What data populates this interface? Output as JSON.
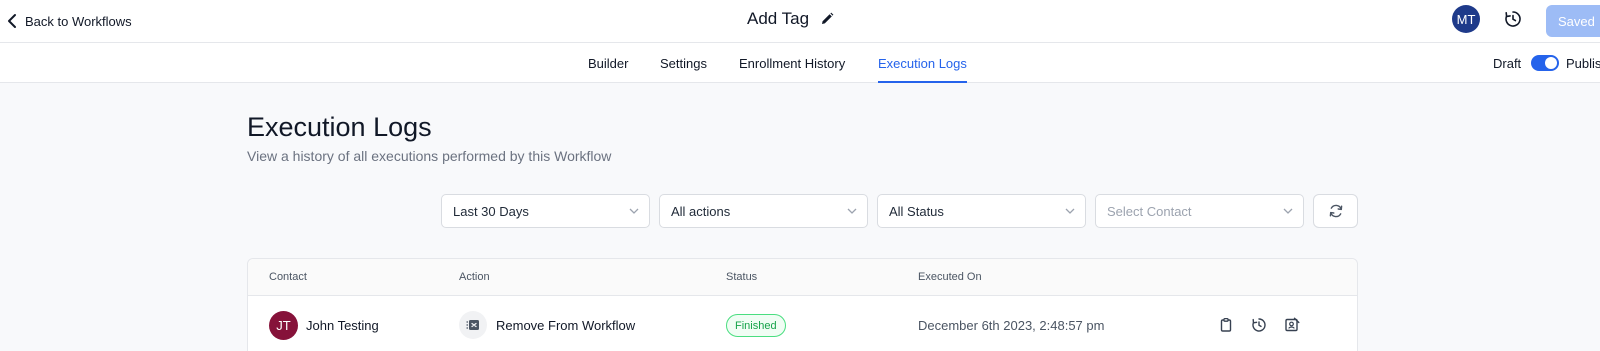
{
  "header": {
    "back_label": "Back to Workflows",
    "title": "Add Tag",
    "avatar_initials": "MT",
    "saved_label": "Saved"
  },
  "tabs": [
    {
      "label": "Builder",
      "active": false
    },
    {
      "label": "Settings",
      "active": false
    },
    {
      "label": "Enrollment History",
      "active": false
    },
    {
      "label": "Execution Logs",
      "active": true
    }
  ],
  "publish_toggle": {
    "draft_label": "Draft",
    "publish_label": "Publish",
    "state": "on"
  },
  "page": {
    "title": "Execution Logs",
    "subtitle": "View a history of all executions performed by this Workflow"
  },
  "filters": {
    "date_range": "Last 30 Days",
    "actions": "All actions",
    "status": "All Status",
    "contact_placeholder": "Select Contact"
  },
  "table": {
    "columns": [
      "Contact",
      "Action",
      "Status",
      "Executed On"
    ],
    "rows": [
      {
        "contact_initials": "JT",
        "contact_name": "John Testing",
        "action": "Remove From Workflow",
        "status": "Finished",
        "executed_on": "December 6th 2023, 2:48:57 pm"
      }
    ]
  },
  "colors": {
    "accent": "#2563eb",
    "saved_button": "#9dbcf6",
    "avatar_mt": "#1e3a8a",
    "avatar_jt": "#86123a",
    "status_finished": "#16a34a"
  }
}
